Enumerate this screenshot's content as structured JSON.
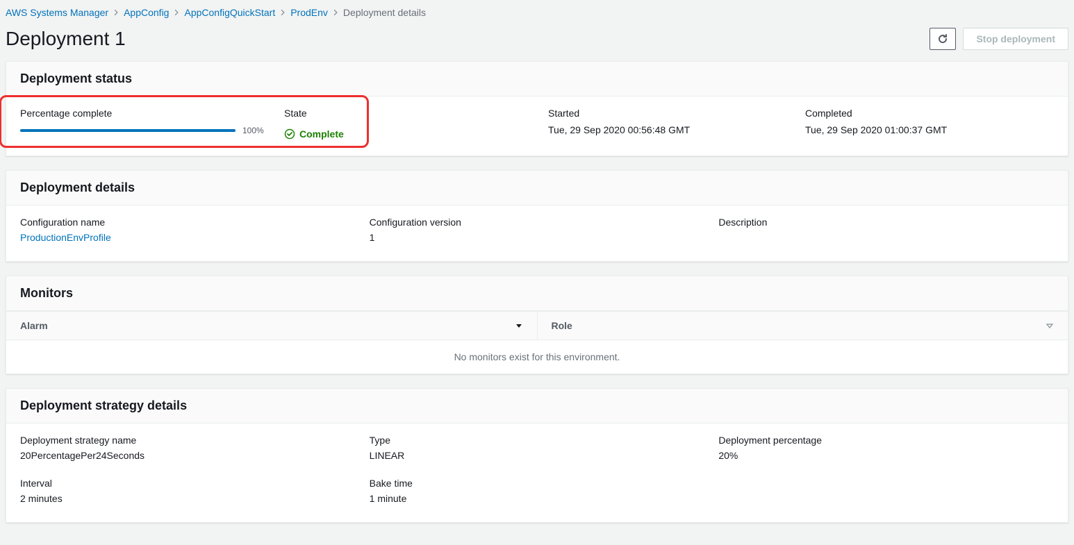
{
  "breadcrumb": {
    "items": [
      {
        "label": "AWS Systems Manager"
      },
      {
        "label": "AppConfig"
      },
      {
        "label": "AppConfigQuickStart"
      },
      {
        "label": "ProdEnv"
      }
    ],
    "current": "Deployment details"
  },
  "page": {
    "title": "Deployment 1",
    "stop_button": "Stop deployment"
  },
  "status": {
    "title": "Deployment status",
    "percentage_label": "Percentage complete",
    "percentage_value": "100%",
    "state_label": "State",
    "state_value": "Complete",
    "started_label": "Started",
    "started_value": "Tue, 29 Sep 2020 00:56:48 GMT",
    "completed_label": "Completed",
    "completed_value": "Tue, 29 Sep 2020 01:00:37 GMT"
  },
  "details": {
    "title": "Deployment details",
    "config_name_label": "Configuration name",
    "config_name_value": "ProductionEnvProfile",
    "config_version_label": "Configuration version",
    "config_version_value": "1",
    "description_label": "Description",
    "description_value": ""
  },
  "monitors": {
    "title": "Monitors",
    "col_alarm": "Alarm",
    "col_role": "Role",
    "empty": "No monitors exist for this environment."
  },
  "strategy": {
    "title": "Deployment strategy details",
    "name_label": "Deployment strategy name",
    "name_value": "20PercentagePer24Seconds",
    "type_label": "Type",
    "type_value": "LINEAR",
    "pct_label": "Deployment percentage",
    "pct_value": "20%",
    "interval_label": "Interval",
    "interval_value": "2 minutes",
    "bake_label": "Bake time",
    "bake_value": "1 minute"
  }
}
